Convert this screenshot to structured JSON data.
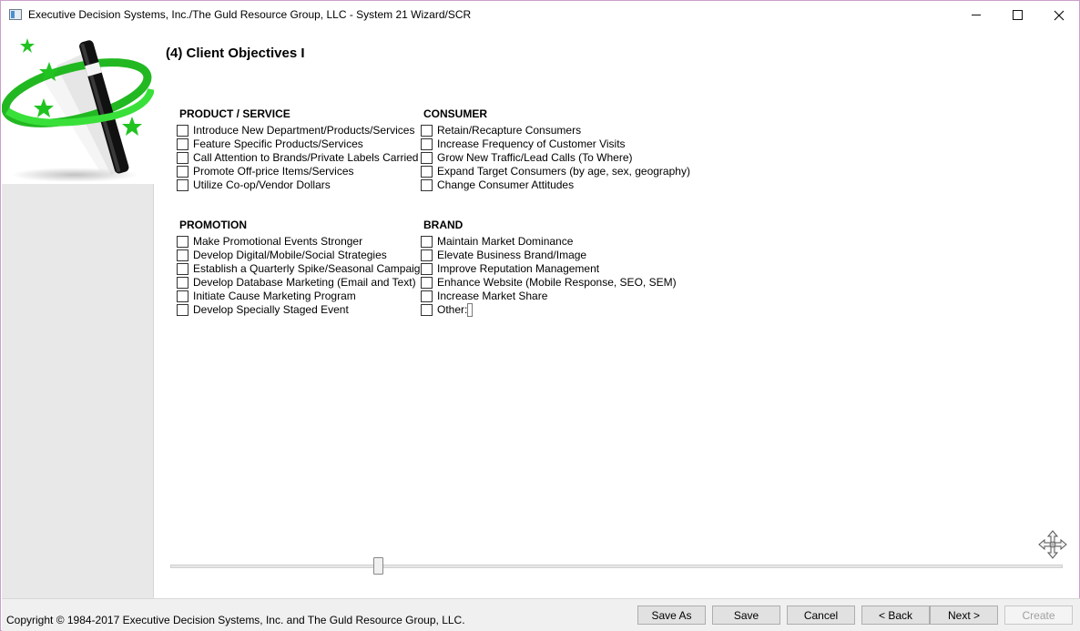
{
  "window": {
    "title": "Executive Decision Systems, Inc./The Guld Resource Group, LLC - System 21 Wizard/SCR"
  },
  "page": {
    "title": "(4) Client Objectives I"
  },
  "sections": {
    "product_service": {
      "heading": "PRODUCT / SERVICE",
      "items": [
        "Introduce New Department/Products/Services",
        "Feature Specific Products/Services",
        "Call Attention to Brands/Private Labels Carried",
        "Promote Off-price Items/Services",
        "Utilize Co-op/Vendor Dollars"
      ]
    },
    "consumer": {
      "heading": "CONSUMER",
      "items": [
        "Retain/Recapture Consumers",
        "Increase Frequency of Customer Visits",
        "Grow New Traffic/Lead Calls (To Where)",
        "Expand Target Consumers (by age, sex, geography)",
        "Change Consumer Attitudes"
      ]
    },
    "promotion": {
      "heading": "PROMOTION",
      "items": [
        "Make Promotional Events Stronger",
        "Develop Digital/Mobile/Social Strategies",
        "Establish a Quarterly Spike/Seasonal Campaign",
        "Develop Database Marketing (Email and Text)",
        "Initiate Cause Marketing Program",
        "Develop Specially Staged Event"
      ]
    },
    "brand": {
      "heading": "BRAND",
      "items": [
        "Maintain Market Dominance",
        "Elevate Business Brand/Image",
        "Improve Reputation Management",
        "Enhance Website (Mobile Response, SEO, SEM)",
        "Increase Market Share",
        "Other:"
      ],
      "other_value": ""
    }
  },
  "slider": {
    "position_fraction": 0.23
  },
  "status": {
    "copyright": "Copyright © 1984-2017 Executive Decision Systems, Inc. and The Guld Resource Group, LLC."
  },
  "buttons": {
    "save_as": "Save As",
    "save": "Save",
    "cancel": "Cancel",
    "back": "< Back",
    "next": "Next >",
    "create": "Create"
  },
  "icons": {
    "app": "window-app-icon",
    "logo": "magic-wand-logo",
    "move": "move-arrows-icon"
  },
  "colors": {
    "logo_green": "#2ecc2e",
    "panel_gray": "#e8e8e8",
    "status_bar": "#f0f0f0"
  }
}
